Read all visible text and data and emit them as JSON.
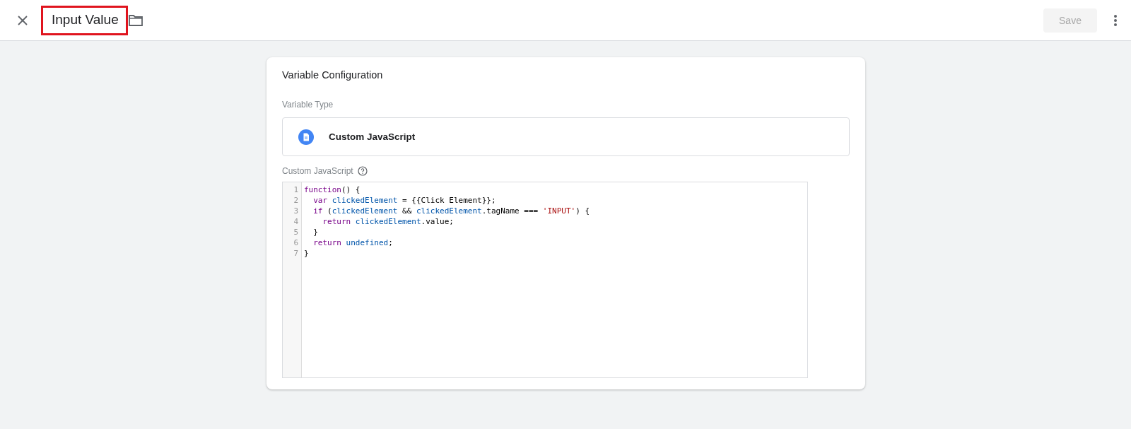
{
  "header": {
    "title": "Input Value",
    "highlighted": true,
    "save_button": {
      "label": "Save",
      "disabled": true
    }
  },
  "card": {
    "title": "Variable Configuration",
    "type_label": "Variable Type",
    "type_name": "Custom JavaScript",
    "code_label": "Custom JavaScript",
    "code_lines": [
      {
        "number": "1",
        "tokens": [
          {
            "kind": "keyword",
            "text": "function"
          },
          {
            "kind": "plain",
            "text": "() {"
          }
        ]
      },
      {
        "number": "2",
        "tokens": [
          {
            "kind": "keyword",
            "text": "  var"
          },
          {
            "kind": "variable",
            "text": " clickedElement"
          },
          {
            "kind": "plain",
            "text": " = {{Click Element}};"
          }
        ]
      },
      {
        "number": "3",
        "tokens": [
          {
            "kind": "keyword",
            "text": "  if"
          },
          {
            "kind": "plain",
            "text": " ("
          },
          {
            "kind": "variable",
            "text": "clickedElement"
          },
          {
            "kind": "plain",
            "text": " && "
          },
          {
            "kind": "variable",
            "text": "clickedElement"
          },
          {
            "kind": "plain",
            "text": ".tagName === "
          },
          {
            "kind": "string",
            "text": "'INPUT'"
          },
          {
            "kind": "plain",
            "text": ") {"
          }
        ]
      },
      {
        "number": "4",
        "tokens": [
          {
            "kind": "keyword",
            "text": "    return"
          },
          {
            "kind": "variable",
            "text": " clickedElement"
          },
          {
            "kind": "plain",
            "text": ".value;"
          }
        ]
      },
      {
        "number": "5",
        "tokens": [
          {
            "kind": "plain",
            "text": "  }"
          }
        ]
      },
      {
        "number": "6",
        "tokens": [
          {
            "kind": "keyword",
            "text": "  return"
          },
          {
            "kind": "variable",
            "text": " undefined"
          },
          {
            "kind": "plain",
            "text": ";"
          }
        ]
      },
      {
        "number": "7",
        "tokens": [
          {
            "kind": "plain",
            "text": "}"
          }
        ]
      }
    ]
  }
}
